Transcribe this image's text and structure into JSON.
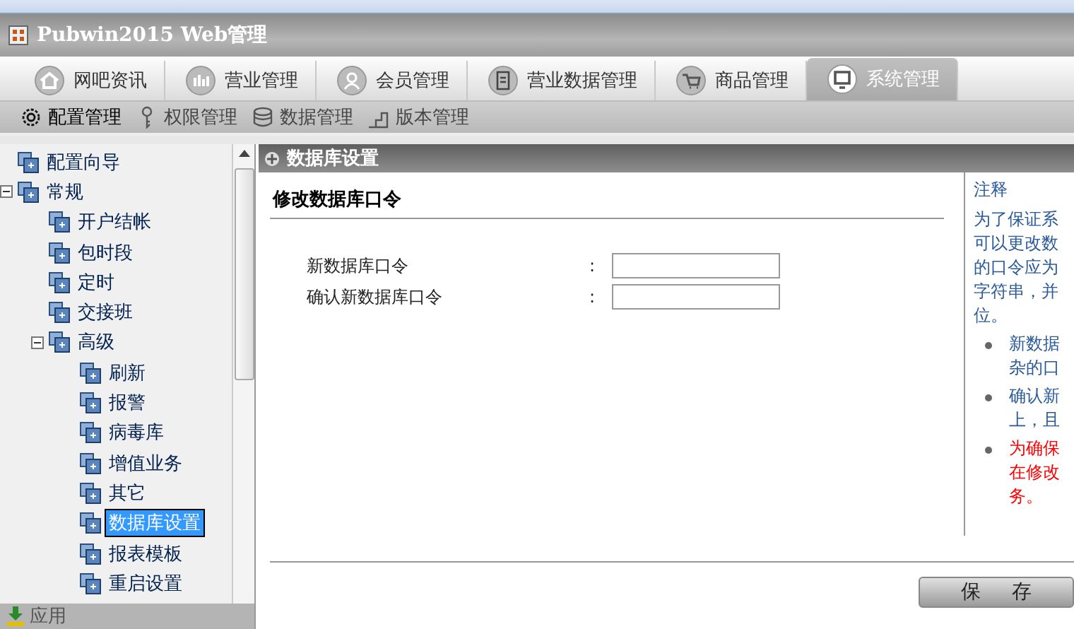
{
  "app_title": "Pubwin2015 Web管理",
  "tabs": [
    {
      "label": "网吧资讯",
      "selected": false
    },
    {
      "label": "营业管理",
      "selected": false
    },
    {
      "label": "会员管理",
      "selected": false
    },
    {
      "label": "营业数据管理",
      "selected": false
    },
    {
      "label": "商品管理",
      "selected": false
    },
    {
      "label": "系统管理",
      "selected": true
    }
  ],
  "subnav": [
    {
      "label": "配置管理",
      "selected": true
    },
    {
      "label": "权限管理",
      "selected": false
    },
    {
      "label": "数据管理",
      "selected": false
    },
    {
      "label": "版本管理",
      "selected": false
    }
  ],
  "tree": [
    {
      "label": "配置向导",
      "selected": false
    },
    {
      "label": "常规",
      "selected": false,
      "expanded": true,
      "children": [
        {
          "label": "开户结帐",
          "selected": false
        },
        {
          "label": "包时段",
          "selected": false
        },
        {
          "label": "定时",
          "selected": false
        },
        {
          "label": "交接班",
          "selected": false
        },
        {
          "label": "高级",
          "selected": false,
          "expanded": true,
          "children": [
            {
              "label": "刷新",
              "selected": false
            },
            {
              "label": "报警",
              "selected": false
            },
            {
              "label": "病毒库",
              "selected": false
            },
            {
              "label": "增值业务",
              "selected": false
            },
            {
              "label": "其它",
              "selected": false
            },
            {
              "label": "数据库设置",
              "selected": true
            },
            {
              "label": "报表模板",
              "selected": false
            },
            {
              "label": "重启设置",
              "selected": false
            }
          ]
        }
      ]
    }
  ],
  "sidebar_footer": "应用",
  "panel_title": "数据库设置",
  "section_title": "修改数据库口令",
  "fields": [
    {
      "label": "新数据库口令",
      "separator": ":"
    },
    {
      "label": "确认新数据库口令",
      "separator": ":"
    }
  ],
  "notes": {
    "title": "注释",
    "lines": [
      "为了保证系",
      "可以更改数",
      "的口令应为",
      "字符串，并",
      "位。"
    ],
    "bullets": [
      {
        "lines": [
          "新数据",
          "杂的口"
        ],
        "color": "#2a5a9a"
      },
      {
        "lines": [
          "确认新",
          "上，且"
        ],
        "color": "#2a5a9a"
      },
      {
        "lines": [
          "为确保",
          "在修改",
          "务。"
        ],
        "color": "#ff0000"
      }
    ]
  },
  "save_button": "保 存"
}
